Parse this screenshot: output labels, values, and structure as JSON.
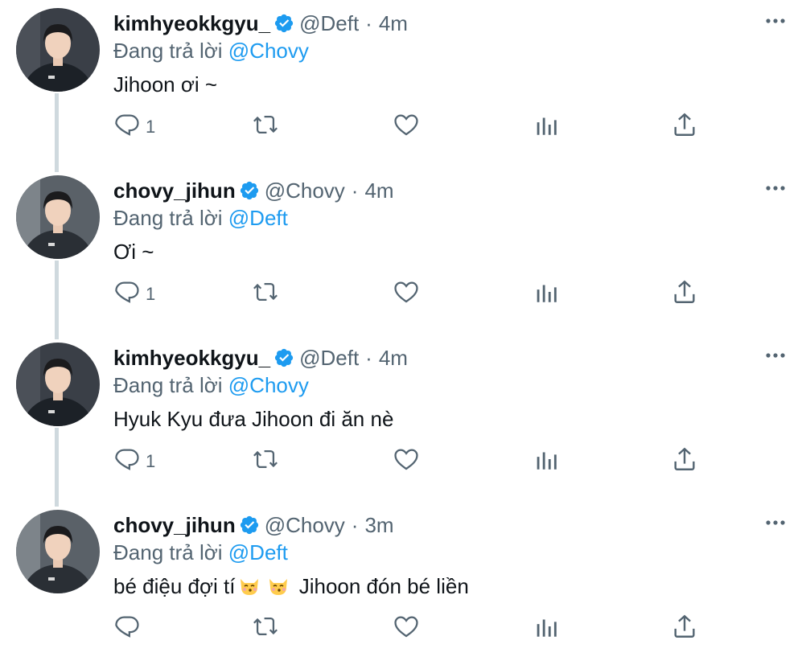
{
  "colors": {
    "link": "#1d9bf0",
    "secondary": "#536471",
    "text": "#0f1419",
    "thread_line": "#cfd9de"
  },
  "tweets": [
    {
      "name": "kimhyeokkgyu_",
      "handle": "@Deft",
      "sep": "·",
      "time": "4m",
      "reply_prefix": "Đang trả lời ",
      "reply_to": "@Chovy",
      "text": "Jihoon ơi ~",
      "text_after": "",
      "reply_count": "1",
      "verified": true,
      "avatar": "deft"
    },
    {
      "name": "chovy_jihun",
      "handle": "@Chovy",
      "sep": "·",
      "time": "4m",
      "reply_prefix": "Đang trả lời ",
      "reply_to": "@Deft",
      "text": "Ơi ~",
      "text_after": "",
      "reply_count": "1",
      "verified": true,
      "avatar": "chovy"
    },
    {
      "name": "kimhyeokkgyu_",
      "handle": "@Deft",
      "sep": "·",
      "time": "4m",
      "reply_prefix": "Đang trả lời ",
      "reply_to": "@Chovy",
      "text": "Hyuk Kyu đưa Jihoon đi ăn nè",
      "text_after": "",
      "reply_count": "1",
      "verified": true,
      "avatar": "deft"
    },
    {
      "name": "chovy_jihun",
      "handle": "@Chovy",
      "sep": "·",
      "time": "3m",
      "reply_prefix": "Đang trả lời ",
      "reply_to": "@Deft",
      "text": "bé điệu đợi tí",
      "text_after": "Jihoon đón bé liền",
      "reply_count": "",
      "verified": true,
      "avatar": "chovy",
      "emojis": [
        "kissing-cat-emoji",
        "kissing-cat-emoji"
      ]
    }
  ]
}
